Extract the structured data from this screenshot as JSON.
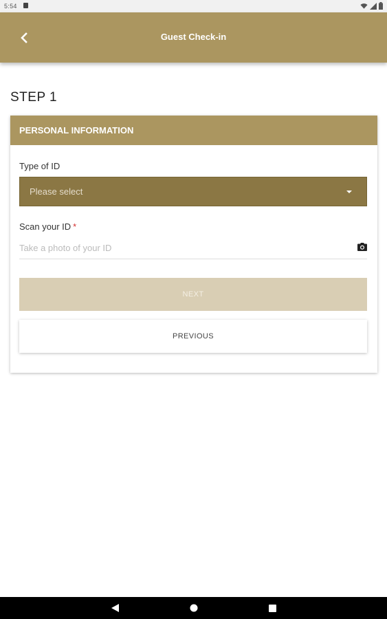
{
  "status_bar": {
    "time": "5:54"
  },
  "app_bar": {
    "title": "Guest Check-in"
  },
  "step": {
    "title": "STEP 1"
  },
  "card": {
    "header": "PERSONAL INFORMATION",
    "id_type": {
      "label": "Type of ID",
      "selected": "Please select"
    },
    "scan_id": {
      "label": "Scan your ID",
      "required_mark": "*",
      "placeholder": "Take a photo of your ID"
    },
    "next_label": "NEXT",
    "previous_label": "PREVIOUS"
  },
  "colors": {
    "brand": "#ab9660",
    "select_bg": "#8b7744",
    "next_disabled_bg": "#d9ceb4",
    "required": "#d32f2f"
  },
  "icons": {
    "back": "back-arrow-icon",
    "caret": "dropdown-caret-icon",
    "camera": "camera-icon",
    "nav": [
      "nav-back-icon",
      "nav-home-icon",
      "nav-recents-icon"
    ]
  }
}
